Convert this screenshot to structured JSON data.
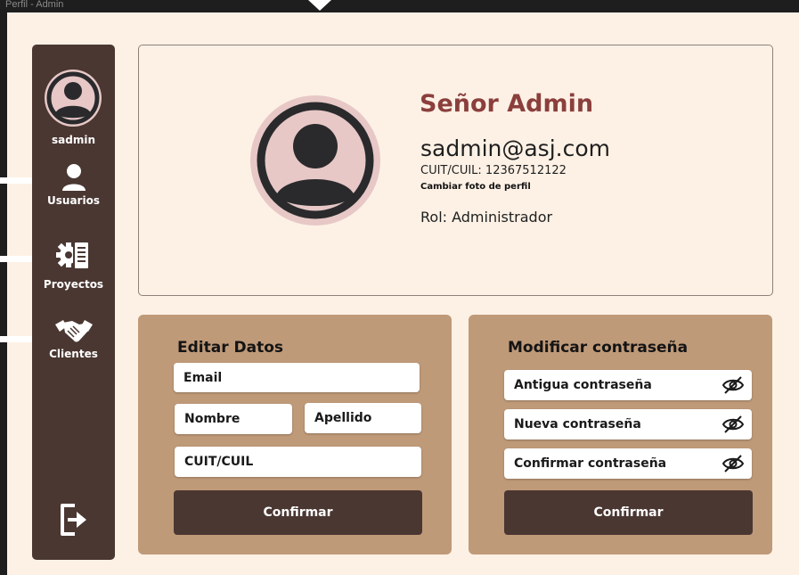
{
  "window": {
    "frame_label": "Perfil - Admin"
  },
  "sidebar": {
    "username": "sadmin",
    "items": [
      {
        "label": "Usuarios",
        "icon": "user-icon"
      },
      {
        "label": "Proyectos",
        "icon": "project-gear-icon"
      },
      {
        "label": "Clientes",
        "icon": "handshake-icon"
      }
    ],
    "logout_icon": "logout-icon"
  },
  "profile": {
    "name": "Señor Admin",
    "email": "sadmin@asj.com",
    "cuit": "CUIT/CUIL: 12367512122",
    "change_photo": "Cambiar foto de perfil",
    "role": "Rol: Administrador"
  },
  "edit_data": {
    "title": "Editar Datos",
    "email": "Email",
    "first_name": "Nombre",
    "last_name": "Apellido",
    "cuit": "CUIT/CUIL",
    "confirm": "Confirmar"
  },
  "change_password": {
    "title": "Modificar contraseña",
    "old": "Antigua contraseña",
    "new": "Nueva contraseña",
    "confirm_field": "Confirmar contraseña",
    "confirm": "Confirmar"
  },
  "colors": {
    "sidebar": "#4a3732",
    "accent_name": "#8b3f3c",
    "panel": "#bf9a79",
    "background": "#fdf1e5",
    "avatar": "#e7c8c7"
  }
}
